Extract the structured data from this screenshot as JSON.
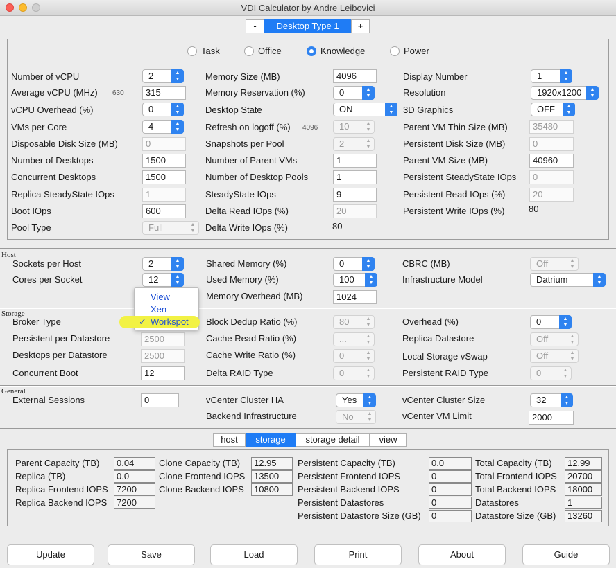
{
  "window": {
    "title": "VDI Calculator by Andre Leibovici"
  },
  "desktop_type": {
    "minus": "-",
    "label": "Desktop Type 1",
    "plus": "+"
  },
  "profiles": {
    "options": [
      "Task",
      "Office",
      "Knowledge",
      "Power"
    ],
    "selected": "Knowledge"
  },
  "desktop": {
    "num_vcpu": {
      "label": "Number of vCPU",
      "value": "2"
    },
    "avg_vcpu": {
      "label": "Average vCPU (MHz)",
      "hint": "630",
      "value": "315"
    },
    "vcpu_overhead": {
      "label": "vCPU Overhead (%)",
      "value": "0"
    },
    "vms_per_core": {
      "label": "VMs per Core",
      "value": "4"
    },
    "disposable_disk": {
      "label": "Disposable Disk Size (MB)",
      "value": "0"
    },
    "num_desktops": {
      "label": "Number of Desktops",
      "value": "1500"
    },
    "concurrent_desktops": {
      "label": "Concurrent Desktops",
      "value": "1500"
    },
    "replica_steady": {
      "label": "Replica SteadyState IOps",
      "value": "1"
    },
    "boot_iops": {
      "label": "Boot IOps",
      "value": "600"
    },
    "pool_type": {
      "label": "Pool Type",
      "value": "Full"
    },
    "memory_size": {
      "label": "Memory Size (MB)",
      "value": "4096"
    },
    "memory_reservation": {
      "label": "Memory Reservation (%)",
      "value": "0"
    },
    "desktop_state": {
      "label": "Desktop State",
      "value": "ON"
    },
    "refresh_logoff": {
      "label": "Refresh on logoff (%)",
      "hint": "4096",
      "value": "10"
    },
    "snapshots_pool": {
      "label": "Snapshots per Pool",
      "value": "2"
    },
    "num_parent_vms": {
      "label": "Number of Parent VMs",
      "value": "1"
    },
    "num_desktop_pools": {
      "label": "Number of Desktop Pools",
      "value": "1"
    },
    "steady_iops": {
      "label": "SteadyState IOps",
      "value": "9"
    },
    "delta_read": {
      "label": "Delta Read IOps (%)",
      "value": "20"
    },
    "delta_write": {
      "label": "Delta Write IOps (%)",
      "value": "80"
    },
    "display_number": {
      "label": "Display Number",
      "value": "1"
    },
    "resolution": {
      "label": "Resolution",
      "value": "1920x1200"
    },
    "graphics_3d": {
      "label": "3D Graphics",
      "value": "OFF"
    },
    "parent_thin": {
      "label": "Parent VM Thin Size (MB)",
      "value": "35480"
    },
    "persistent_disk": {
      "label": "Persistent Disk Size (MB)",
      "value": "0"
    },
    "parent_size": {
      "label": "Parent VM Size (MB)",
      "value": "40960"
    },
    "persistent_steady": {
      "label": "Persistent SteadyState IOps",
      "value": "0"
    },
    "persistent_read": {
      "label": "Persistent Read IOps (%)",
      "value": "20"
    },
    "persistent_write": {
      "label": "Persistent Write IOps (%)",
      "value": "80"
    }
  },
  "host": {
    "section": "Host",
    "sockets": {
      "label": "Sockets per Host",
      "value": "2"
    },
    "cores": {
      "label": "Cores per Socket",
      "value": "12"
    },
    "shared_memory": {
      "label": "Shared Memory (%)",
      "value": "0"
    },
    "used_memory": {
      "label": "Used Memory (%)",
      "value": "100"
    },
    "memory_overhead": {
      "label": "Memory Overhead (MB)",
      "value": "1024"
    },
    "cbrc": {
      "label": "CBRC (MB)",
      "value": "Off"
    },
    "infra_model": {
      "label": "Infrastructure Model",
      "value": "Datrium"
    }
  },
  "storage": {
    "section": "Storage",
    "broker_type": {
      "label": "Broker Type",
      "options": [
        "View",
        "Xen",
        "Workspot"
      ],
      "selected": "Workspot",
      "check": "✓"
    },
    "persistent_per_ds": {
      "label": "Persistent per Datastore",
      "value": "2500"
    },
    "desktops_per_ds": {
      "label": "Desktops per Datastore",
      "value": "2500"
    },
    "concurrent_boot": {
      "label": "Concurrent Boot",
      "value": "12"
    },
    "block_dedup": {
      "label": "Block Dedup Ratio (%)",
      "value": "80"
    },
    "cache_read": {
      "label": "Cache Read Ratio (%)",
      "value": "..."
    },
    "cache_write": {
      "label": "Cache Write Ratio (%)",
      "value": "0"
    },
    "delta_raid": {
      "label": "Delta RAID Type",
      "value": "0"
    },
    "overhead": {
      "label": "Overhead (%)",
      "value": "0"
    },
    "replica_ds": {
      "label": "Replica Datastore",
      "value": "Off"
    },
    "local_vswap": {
      "label": "Local Storage vSwap",
      "value": "Off"
    },
    "persistent_raid": {
      "label": "Persistent RAID Type",
      "value": "0"
    }
  },
  "general": {
    "section": "General",
    "external_sessions": {
      "label": "External Sessions",
      "value": "0"
    },
    "vcenter_ha": {
      "label": "vCenter Cluster HA",
      "value": "Yes"
    },
    "backend_infra": {
      "label": "Backend Infrastructure",
      "value": "No"
    },
    "vcenter_size": {
      "label": "vCenter Cluster Size",
      "value": "32"
    },
    "vcenter_vm_limit": {
      "label": "vCenter VM Limit",
      "value": "2000"
    }
  },
  "results_tabs": {
    "tabs": [
      "host",
      "storage",
      "storage detail",
      "view"
    ],
    "selected": "storage"
  },
  "results": {
    "col1": [
      {
        "label": "Parent Capacity (TB)",
        "value": "0.04"
      },
      {
        "label": "Replica (TB)",
        "value": "0.0"
      },
      {
        "label": "Replica Frontend IOPS",
        "value": "7200"
      },
      {
        "label": "Replica Backend IOPS",
        "value": "7200"
      }
    ],
    "col2": [
      {
        "label": "Clone Capacity (TB)",
        "value": "12.95"
      },
      {
        "label": "Clone Frontend IOPS",
        "value": "13500"
      },
      {
        "label": "Clone Backend IOPS",
        "value": "10800"
      }
    ],
    "col3": [
      {
        "label": "Persistent Capacity (TB)",
        "value": "0.0"
      },
      {
        "label": "Persistent Frontend IOPS",
        "value": "0"
      },
      {
        "label": "Persistent Backend IOPS",
        "value": "0"
      },
      {
        "label": "Persistent Datastores",
        "value": "0"
      },
      {
        "label": "Persistent Datastore Size (GB)",
        "value": "0"
      }
    ],
    "col4": [
      {
        "label": "Total Capacity (TB)",
        "value": "12.99"
      },
      {
        "label": "Total Frontend IOPS",
        "value": "20700"
      },
      {
        "label": "Total Backend IOPS",
        "value": "18000"
      },
      {
        "label": "Datastores",
        "value": "1"
      },
      {
        "label": "Datastore Size (GB)",
        "value": "13260"
      }
    ]
  },
  "buttons": {
    "update": "Update",
    "save": "Save",
    "load": "Load",
    "print": "Print",
    "about": "About",
    "guide": "Guide"
  },
  "colors": {
    "accent": "#2f83f0",
    "highlight": "#f2f244",
    "menu_text": "#1d4fd6"
  }
}
